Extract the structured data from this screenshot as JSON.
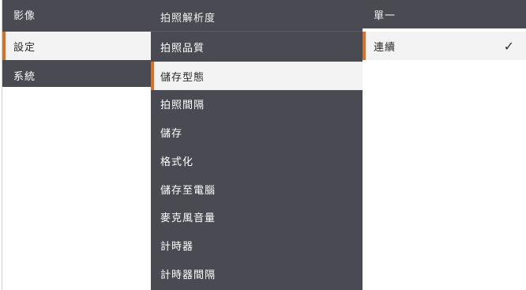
{
  "column1": {
    "items": [
      {
        "label": "影像"
      },
      {
        "label": "設定"
      },
      {
        "label": "系統"
      }
    ],
    "selected_index": 1
  },
  "column2": {
    "items": [
      {
        "label": "拍照解析度"
      },
      {
        "label": "拍照品質"
      },
      {
        "label": "儲存型態"
      },
      {
        "label": "拍照間隔"
      },
      {
        "label": "儲存"
      },
      {
        "label": "格式化"
      },
      {
        "label": "儲存至電腦"
      },
      {
        "label": "麥克風音量"
      },
      {
        "label": "計時器"
      },
      {
        "label": "計時器間隔"
      }
    ],
    "selected_index": 2
  },
  "column3": {
    "items": [
      {
        "label": "單一"
      },
      {
        "label": "連續"
      }
    ],
    "selected_index": 1,
    "check_glyph": "✓"
  },
  "colors": {
    "panel": "#4a4b52",
    "accent": "#d9702a",
    "selected_bg": "#f3f3f3"
  }
}
